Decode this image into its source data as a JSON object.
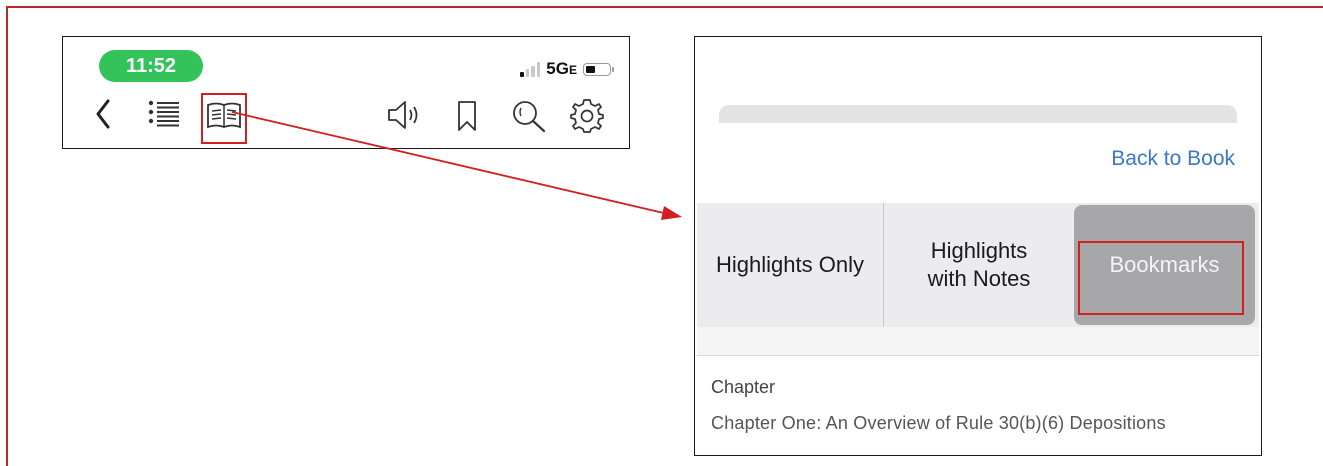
{
  "status_bar": {
    "time": "11:52",
    "network": "5G",
    "network_suffix": "E"
  },
  "toolbar": {
    "icons": [
      "back-icon",
      "table-of-contents-icon",
      "book-notes-icon",
      "audio-icon",
      "bookmark-icon",
      "search-icon",
      "settings-icon"
    ]
  },
  "annotations_panel": {
    "back_link": "Back to Book",
    "tabs": [
      {
        "label_line1": "Highlights Only",
        "label_line2": ""
      },
      {
        "label_line1": "Highlights",
        "label_line2": "with Notes"
      },
      {
        "label_line1": "Bookmarks",
        "label_line2": ""
      }
    ],
    "selected_tab": "Bookmarks",
    "list": {
      "section_label": "Chapter",
      "chapter_title": "Chapter One: An Overview of Rule 30(b)(6) Depositions"
    }
  },
  "colors": {
    "frame": "#b52a2a",
    "callout": "#d02020",
    "time_pill": "#34c25a",
    "link": "#3b78c4",
    "segment_bg": "#ececef",
    "segment_active": "#a7a7a9"
  }
}
